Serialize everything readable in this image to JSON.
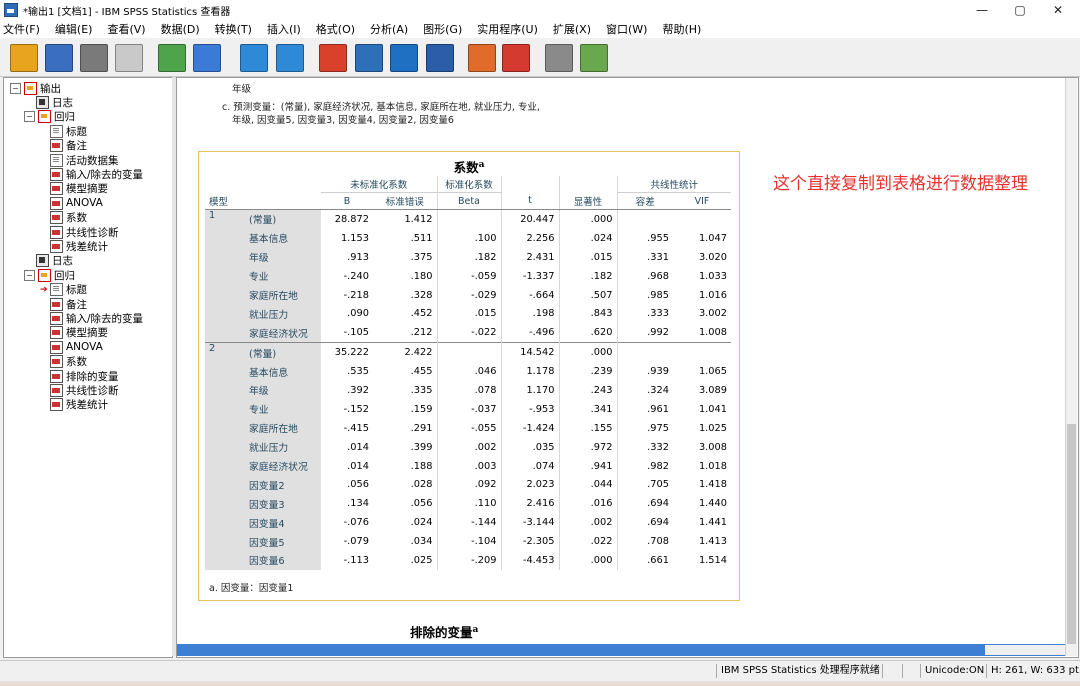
{
  "window": {
    "title": "*输出1 [文档1] - IBM SPSS Statistics 查看器",
    "min_glyph": "—",
    "max_glyph": "▢",
    "close_glyph": "✕"
  },
  "menu": [
    "文件(F)",
    "编辑(E)",
    "查看(V)",
    "数据(D)",
    "转换(T)",
    "插入(I)",
    "格式(O)",
    "分析(A)",
    "图形(G)",
    "实用程序(U)",
    "扩展(X)",
    "窗口(W)",
    "帮助(H)"
  ],
  "toolbar_icons": [
    "open-icon",
    "save-icon",
    "print-icon",
    "print-preview-icon",
    "export-icon",
    "recall-dialog-icon",
    "undo-icon",
    "redo-icon",
    "goto-data-icon",
    "goto-case-icon",
    "goto-variable-icon",
    "variables-icon",
    "show-all-icon",
    "designate-window-icon",
    "promote-icon",
    "insert-output-icon"
  ],
  "tree": [
    {
      "label": "输出",
      "indent": 0,
      "icon": "folder-red",
      "exp": "−"
    },
    {
      "label": "日志",
      "indent": 1,
      "icon": "log"
    },
    {
      "label": "回归",
      "indent": 1,
      "icon": "folder-red",
      "exp": "−"
    },
    {
      "label": "标题",
      "indent": 2,
      "icon": "doc"
    },
    {
      "label": "备注",
      "indent": 2,
      "icon": "table"
    },
    {
      "label": "活动数据集",
      "indent": 2,
      "icon": "doc"
    },
    {
      "label": "输入/除去的变量",
      "indent": 2,
      "icon": "table"
    },
    {
      "label": "模型摘要",
      "indent": 2,
      "icon": "table"
    },
    {
      "label": "ANOVA",
      "indent": 2,
      "icon": "table"
    },
    {
      "label": "系数",
      "indent": 2,
      "icon": "table"
    },
    {
      "label": "共线性诊断",
      "indent": 2,
      "icon": "table"
    },
    {
      "label": "残差统计",
      "indent": 2,
      "icon": "table"
    },
    {
      "label": "日志",
      "indent": 1,
      "icon": "log"
    },
    {
      "label": "回归",
      "indent": 1,
      "icon": "folder-red",
      "exp": "−"
    },
    {
      "label": "标题",
      "indent": 2,
      "icon": "doc",
      "arrow": true
    },
    {
      "label": "备注",
      "indent": 2,
      "icon": "table"
    },
    {
      "label": "输入/除去的变量",
      "indent": 2,
      "icon": "table"
    },
    {
      "label": "模型摘要",
      "indent": 2,
      "icon": "table"
    },
    {
      "label": "ANOVA",
      "indent": 2,
      "icon": "table"
    },
    {
      "label": "系数",
      "indent": 2,
      "icon": "table"
    },
    {
      "label": "排除的变量",
      "indent": 2,
      "icon": "table"
    },
    {
      "label": "共线性诊断",
      "indent": 2,
      "icon": "table"
    },
    {
      "label": "残差统计",
      "indent": 2,
      "icon": "table"
    }
  ],
  "notes": {
    "top_fragment": "年级",
    "c_line1": "c. 预测变量：(常量), 家庭经济状况, 基本信息, 家庭所在地, 就业压力, 专业,",
    "c_line2": "年级, 因变量5, 因变量3, 因变量4, 因变量2, 因变量6"
  },
  "coef_table": {
    "title": "系数",
    "title_sup": "a",
    "group_unstd": "未标准化系数",
    "group_std": "标准化系数",
    "group_collin": "共线性统计",
    "col_model": "模型",
    "col_B": "B",
    "col_se": "标准错误",
    "col_beta": "Beta",
    "col_t": "t",
    "col_sig": "显著性",
    "col_tol": "容差",
    "col_vif": "VIF",
    "models": [
      {
        "model": "1",
        "rows": [
          {
            "label": "(常量)",
            "B": "28.872",
            "se": "1.412",
            "beta": "",
            "t": "20.447",
            "sig": ".000",
            "tol": "",
            "vif": ""
          },
          {
            "label": "基本信息",
            "B": "1.153",
            "se": ".511",
            "beta": ".100",
            "t": "2.256",
            "sig": ".024",
            "tol": ".955",
            "vif": "1.047"
          },
          {
            "label": "年级",
            "B": ".913",
            "se": ".375",
            "beta": ".182",
            "t": "2.431",
            "sig": ".015",
            "tol": ".331",
            "vif": "3.020"
          },
          {
            "label": "专业",
            "B": "-.240",
            "se": ".180",
            "beta": "-.059",
            "t": "-1.337",
            "sig": ".182",
            "tol": ".968",
            "vif": "1.033"
          },
          {
            "label": "家庭所在地",
            "B": "-.218",
            "se": ".328",
            "beta": "-.029",
            "t": "-.664",
            "sig": ".507",
            "tol": ".985",
            "vif": "1.016"
          },
          {
            "label": "就业压力",
            "B": ".090",
            "se": ".452",
            "beta": ".015",
            "t": ".198",
            "sig": ".843",
            "tol": ".333",
            "vif": "3.002"
          },
          {
            "label": "家庭经济状况",
            "B": "-.105",
            "se": ".212",
            "beta": "-.022",
            "t": "-.496",
            "sig": ".620",
            "tol": ".992",
            "vif": "1.008"
          }
        ]
      },
      {
        "model": "2",
        "rows": [
          {
            "label": "(常量)",
            "B": "35.222",
            "se": "2.422",
            "beta": "",
            "t": "14.542",
            "sig": ".000",
            "tol": "",
            "vif": ""
          },
          {
            "label": "基本信息",
            "B": ".535",
            "se": ".455",
            "beta": ".046",
            "t": "1.178",
            "sig": ".239",
            "tol": ".939",
            "vif": "1.065"
          },
          {
            "label": "年级",
            "B": ".392",
            "se": ".335",
            "beta": ".078",
            "t": "1.170",
            "sig": ".243",
            "tol": ".324",
            "vif": "3.089"
          },
          {
            "label": "专业",
            "B": "-.152",
            "se": ".159",
            "beta": "-.037",
            "t": "-.953",
            "sig": ".341",
            "tol": ".961",
            "vif": "1.041"
          },
          {
            "label": "家庭所在地",
            "B": "-.415",
            "se": ".291",
            "beta": "-.055",
            "t": "-1.424",
            "sig": ".155",
            "tol": ".975",
            "vif": "1.025"
          },
          {
            "label": "就业压力",
            "B": ".014",
            "se": ".399",
            "beta": ".002",
            "t": ".035",
            "sig": ".972",
            "tol": ".332",
            "vif": "3.008"
          },
          {
            "label": "家庭经济状况",
            "B": ".014",
            "se": ".188",
            "beta": ".003",
            "t": ".074",
            "sig": ".941",
            "tol": ".982",
            "vif": "1.018"
          },
          {
            "label": "因变量2",
            "B": ".056",
            "se": ".028",
            "beta": ".092",
            "t": "2.023",
            "sig": ".044",
            "tol": ".705",
            "vif": "1.418"
          },
          {
            "label": "因变量3",
            "B": ".134",
            "se": ".056",
            "beta": ".110",
            "t": "2.416",
            "sig": ".016",
            "tol": ".694",
            "vif": "1.440"
          },
          {
            "label": "因变量4",
            "B": "-.076",
            "se": ".024",
            "beta": "-.144",
            "t": "-3.144",
            "sig": ".002",
            "tol": ".694",
            "vif": "1.441"
          },
          {
            "label": "因变量5",
            "B": "-.079",
            "se": ".034",
            "beta": "-.104",
            "t": "-2.305",
            "sig": ".022",
            "tol": ".708",
            "vif": "1.413"
          },
          {
            "label": "因变量6",
            "B": "-.113",
            "se": ".025",
            "beta": "-.209",
            "t": "-4.453",
            "sig": ".000",
            "tol": ".661",
            "vif": "1.514"
          }
        ]
      }
    ],
    "footnote": "a. 因变量：因变量1"
  },
  "annotation": "这个直接复制到表格进行数据整理",
  "next_table": {
    "title": "排除的变量",
    "sup": "a"
  },
  "status": {
    "processor": "IBM SPSS Statistics 处理程序就绪",
    "unicode": "Unicode:ON",
    "dims": "H: 261, W: 633 pt."
  },
  "colors": {
    "accent_red": "#e8302f",
    "table_border": "#e6c35c",
    "header_blue": "#264a60",
    "scroll_blue": "#3d7fd3"
  }
}
